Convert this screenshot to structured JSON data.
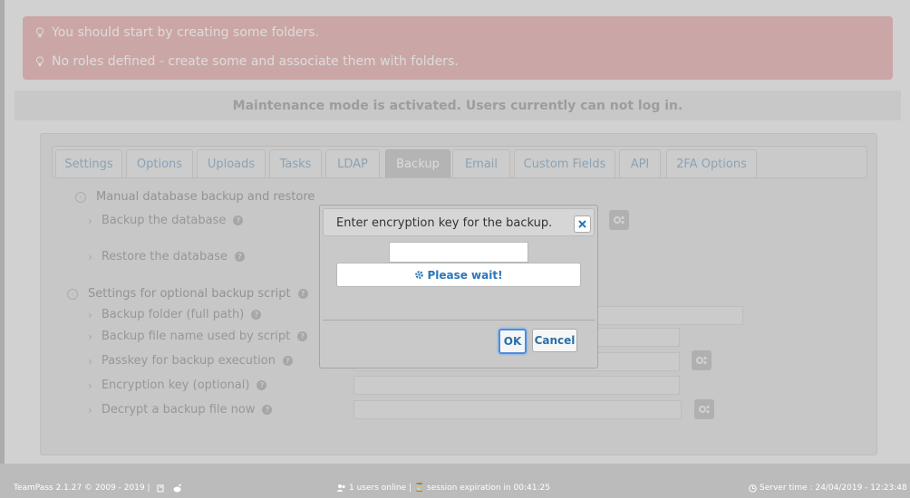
{
  "alerts": [
    "You should start by creating some folders.",
    "No roles defined - create some and associate them with folders."
  ],
  "maintenance": "Maintenance mode is activated. Users currently can not log in.",
  "tabs": [
    "Settings",
    "Options",
    "Uploads",
    "Tasks",
    "LDAP",
    "Backup",
    "Email",
    "Custom Fields",
    "API",
    "2FA Options"
  ],
  "active_tab": "Backup",
  "section1": {
    "title": "Manual database backup and restore",
    "items": [
      "Backup the database",
      "Restore the database"
    ]
  },
  "section2": {
    "title": "Settings for optional backup script",
    "items": [
      "Backup folder (full path)",
      "Backup file name used by script",
      "Passkey for backup execution",
      "Encryption key (optional)",
      "Decrypt a backup file now"
    ]
  },
  "dialog": {
    "title": "Enter encryption key for the backup.",
    "status": "Please wait!",
    "ok_label": "OK",
    "cancel_label": "Cancel",
    "key_value": ""
  },
  "footer": {
    "left": "TeamPass 2.1.27 © 2009 - 2019 |",
    "center": "1 users online | ⏳ session expiration in 00:41:25",
    "right": "Server time : 24/04/2019 - 12:23:48"
  },
  "colors": {
    "alert_bg": "#e8b4b4",
    "link_blue": "#2a77b8",
    "ok_border": "#4a8ede"
  },
  "icons": [
    "lightbulb-icon",
    "question-icon",
    "gear-icon",
    "close-icon",
    "users-icon",
    "clock-icon",
    "book-icon",
    "reddit-icon"
  ]
}
